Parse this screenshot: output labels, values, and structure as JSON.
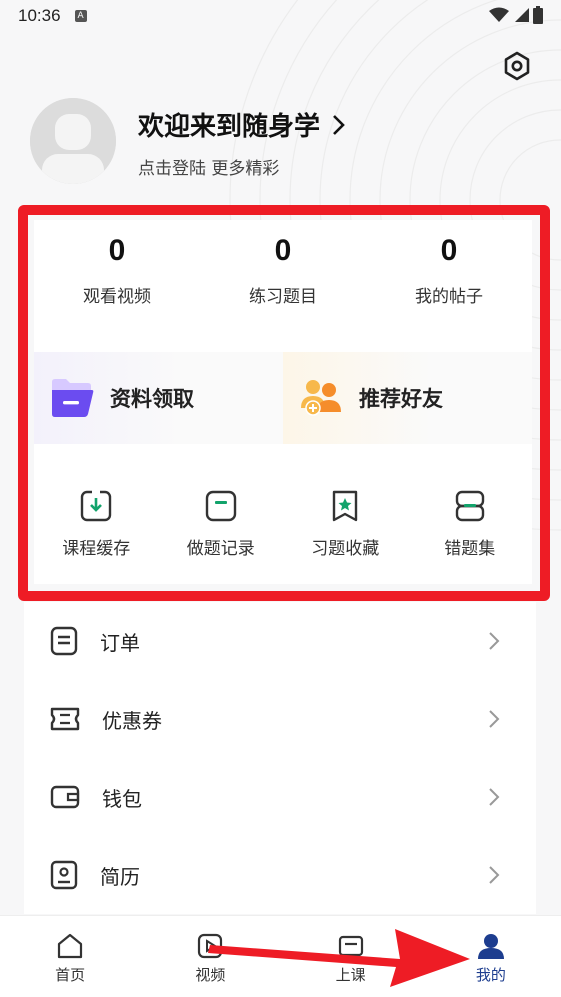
{
  "status_bar": {
    "time": "10:36",
    "badge": "A"
  },
  "profile": {
    "title": "欢迎来到随身学",
    "subtitle": "点击登陆 更多精彩"
  },
  "stats": [
    {
      "value": "0",
      "label": "观看视频"
    },
    {
      "value": "0",
      "label": "练习题目"
    },
    {
      "value": "0",
      "label": "我的帖子"
    }
  ],
  "promos": [
    {
      "label": "资料领取",
      "icon": "folder-icon"
    },
    {
      "label": "推荐好友",
      "icon": "add-friend-icon"
    }
  ],
  "tools": [
    {
      "label": "课程缓存",
      "icon": "download-icon"
    },
    {
      "label": "做题记录",
      "icon": "record-icon"
    },
    {
      "label": "习题收藏",
      "icon": "bookmark-star-icon"
    },
    {
      "label": "错题集",
      "icon": "wrong-book-icon"
    }
  ],
  "menu": [
    {
      "label": "订单",
      "icon": "order-icon"
    },
    {
      "label": "优惠券",
      "icon": "coupon-icon"
    },
    {
      "label": "钱包",
      "icon": "wallet-icon"
    },
    {
      "label": "简历",
      "icon": "resume-icon"
    }
  ],
  "tabs": [
    {
      "label": "首页",
      "icon": "home-icon"
    },
    {
      "label": "视频",
      "icon": "video-icon"
    },
    {
      "label": "上课",
      "icon": "class-icon"
    },
    {
      "label": "我的",
      "icon": "user-icon",
      "active": true
    }
  ],
  "colors": {
    "accent": "#1d3d8f",
    "highlight_frame": "#ee1c25",
    "tool_icon_green": "#12a36b",
    "promo_purple": "#6b4cf0",
    "promo_orange": "#f7a23b"
  }
}
